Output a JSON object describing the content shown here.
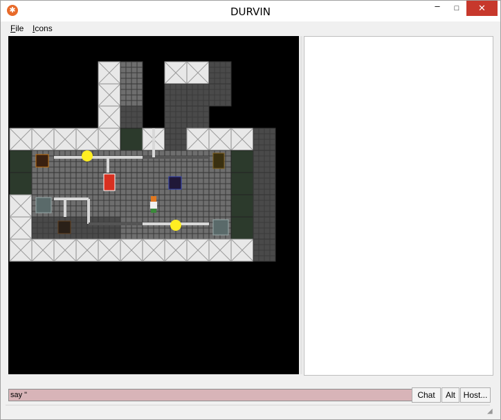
{
  "window": {
    "title": "DURVIN",
    "controls": {
      "minimize": "–",
      "maximize": "□",
      "close": "✕"
    },
    "icon": "asterisk-icon"
  },
  "menu": {
    "items": [
      "File",
      "Icons"
    ]
  },
  "map": {
    "background": "#000000",
    "tile_colors": {
      "wall": "#e8e8e8",
      "floor": "#6e6e6e",
      "dark_floor": "#4a4a4a",
      "grille": "#2c3a2c",
      "pipe": "#d8d8d8",
      "light": "#ffee22",
      "canister": "#d83020",
      "vent_blue": "#3040b0",
      "vent_orange": "#c07010"
    }
  },
  "input": {
    "value": "say \""
  },
  "buttons": {
    "chat": "Chat",
    "alt": "Alt",
    "host": "Host..."
  }
}
